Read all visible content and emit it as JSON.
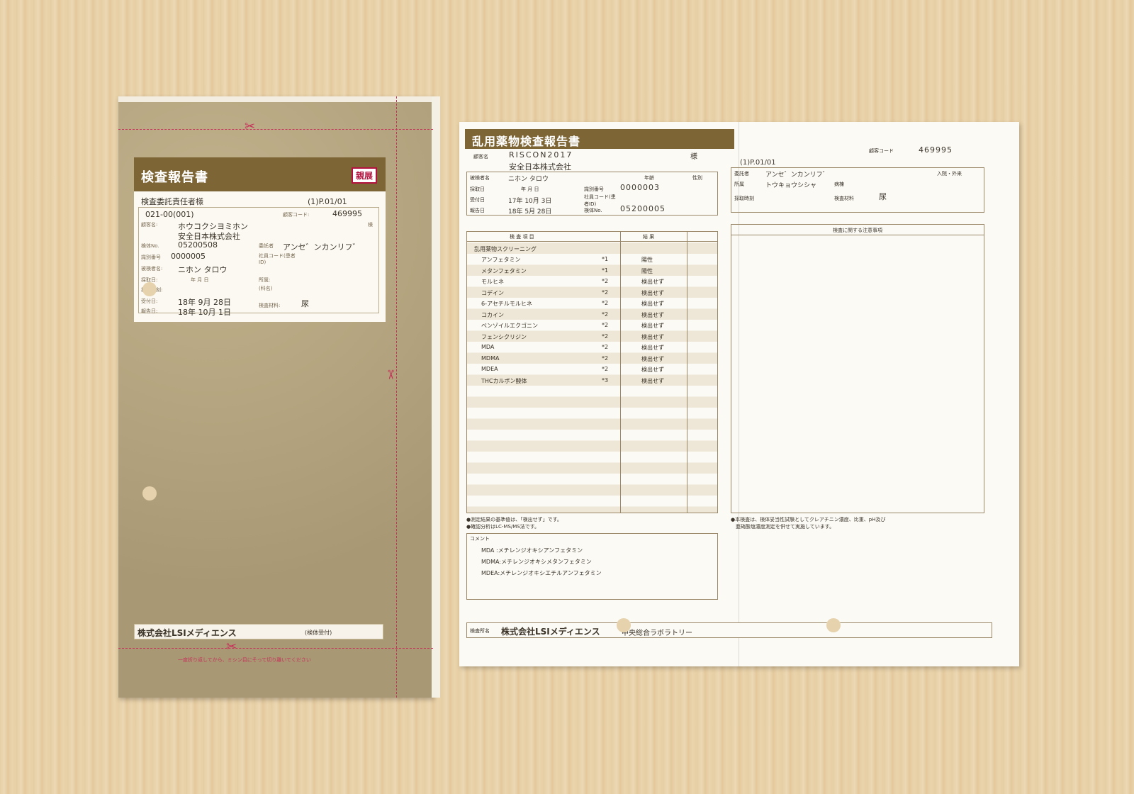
{
  "envelope": {
    "title": "検査報告書",
    "badge": "親展",
    "recipient": "検査委託責任者様",
    "page": "(1)P.01/01",
    "code_line": "021-00(001)",
    "customer_code_label": "顧客コード:",
    "customer_code": "469995",
    "customer_label": "顧客名:",
    "customer_kana": "ホウコクシヨミホン",
    "customer_name": "安全日本株式会社",
    "sama": "様",
    "specimen_no_label": "検体No.",
    "specimen_no": "05200508",
    "consignor_label": "委託者",
    "consignor": "アンセ゛ンカンリフ゛",
    "id_no_label": "識別番号",
    "id_no": "0000005",
    "employee_code_label": "社員コード(患者ID)",
    "subject_label": "被検者名:",
    "subject": "ニホン タロウ",
    "collected_label": "採取日:",
    "collected_ymd": "年 月 日",
    "collect_time_label": "採取時刻:",
    "dept_label": "所属:",
    "dept_sub": "(科名)",
    "received_label": "受付日:",
    "received": "18年 9月 28日",
    "reported_label": "報告日:",
    "reported": "18年 10月 1日",
    "material_label": "検査材料:",
    "material": "尿",
    "footer_company": "株式会社LSIメディエンス",
    "footer_note": "(検体受付)",
    "bottom_note": "一度折り返してから、ミシン目にそって切り離いてください"
  },
  "report": {
    "title": "乱用薬物検査報告書",
    "customer_label": "顧客名",
    "customer": "RISCON2017",
    "customer_name": "安全日本株式会社",
    "sama": "様",
    "subject_label": "被検者名",
    "subject": "ニホン タロウ",
    "age_label": "年齢",
    "sex_label": "性別",
    "collected_label": "採取日",
    "collected": "年 月 日",
    "id_label": "識別番号",
    "id_no": "0000003",
    "received_label": "受付日",
    "received": "17年 10月 3日",
    "employee_label": "社員コード(患者ID)",
    "reported_label": "報告日",
    "reported": "18年 5月 28日",
    "specimen_label": "検体No.",
    "specimen_no": "05200005",
    "table_headers": [
      "検 査 項 目",
      "結 果"
    ],
    "section": "乱用薬物スクリーニング",
    "rows": [
      {
        "item": "アンフェタミン",
        "mark": "*1",
        "result": "陽性"
      },
      {
        "item": "メタンフェタミン",
        "mark": "*1",
        "result": "陽性"
      },
      {
        "item": "モルヒネ",
        "mark": "*2",
        "result": "検出せず"
      },
      {
        "item": "コデイン",
        "mark": "*2",
        "result": "検出せず"
      },
      {
        "item": "6-アセチルモルヒネ",
        "mark": "*2",
        "result": "検出せず"
      },
      {
        "item": "コカイン",
        "mark": "*2",
        "result": "検出せず"
      },
      {
        "item": "ベンゾイルエクゴニン",
        "mark": "*2",
        "result": "検出せず"
      },
      {
        "item": "フェンシクリジン",
        "mark": "*2",
        "result": "検出せず"
      },
      {
        "item": "MDA",
        "mark": "*2",
        "result": "検出せず"
      },
      {
        "item": "MDMA",
        "mark": "*2",
        "result": "検出せず"
      },
      {
        "item": "MDEA",
        "mark": "*2",
        "result": "検出せず"
      },
      {
        "item": "THCカルボン酸体",
        "mark": "*3",
        "result": "検出せず"
      }
    ],
    "notes": [
      "●測定結果の基準値は、「検出せず」です。",
      "●確認分析はLC-MS/MS法です。"
    ],
    "comment_label": "コメント",
    "comments": [
      "MDA :メチレンジオキシアンフェタミン",
      "MDMA:メチレンジオキシメタンフェタミン",
      "MDEA:メチレンジオキシエチルアンフェタミン"
    ],
    "right_customer_code_label": "顧客コード",
    "right_customer_code": "469995",
    "right_page": "(1)P.01/01",
    "consignor_label": "委託者",
    "consignor": "アンセ゛ンカンリフ゛",
    "inout_label": "入院・外来",
    "dept_label": "所属",
    "dept": "トウキョウシシャ",
    "ward_label": "病棟",
    "time_label": "採取時刻",
    "material_label": "検査材料",
    "material": "尿",
    "caution_label": "検査に関する注意事項",
    "right_note_1": "●本検査は、検体妥当性試験としてクレアチニン濃度、比重、pH及び",
    "right_note_2": "亜硝酸塩濃度測定を併せて実施しています。",
    "lab_label": "検査所名",
    "lab_company": "株式会社LSIメディエンス",
    "lab_name": "中央総合ラボラトリー"
  }
}
